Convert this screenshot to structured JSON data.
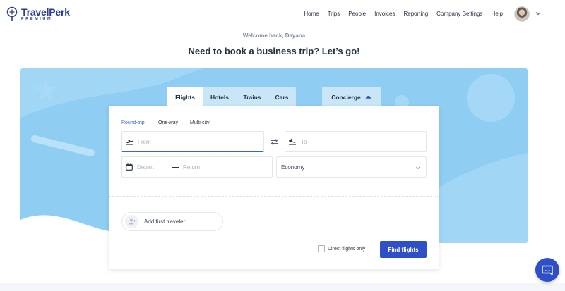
{
  "brand": {
    "name": "TravelPerk",
    "tier": "PREMIUM"
  },
  "nav": {
    "items": [
      {
        "label": "Home"
      },
      {
        "label": "Trips"
      },
      {
        "label": "People"
      },
      {
        "label": "Invoices"
      },
      {
        "label": "Reporting"
      },
      {
        "label": "Company Settings"
      },
      {
        "label": "Help"
      }
    ]
  },
  "greeting": {
    "welcome": "Welcome back, Dayana",
    "headline": "Need to book a business trip? Let’s go!"
  },
  "tabs": [
    {
      "label": "Flights",
      "active": true
    },
    {
      "label": "Hotels",
      "active": false
    },
    {
      "label": "Trains",
      "active": false
    },
    {
      "label": "Cars",
      "active": false
    }
  ],
  "concierge": {
    "label": "Concierge",
    "icon": "concierge-bell-icon"
  },
  "trip_types": [
    {
      "label": "Round-trip",
      "selected": true
    },
    {
      "label": "One-way",
      "selected": false
    },
    {
      "label": "Multi-city",
      "selected": false
    }
  ],
  "search": {
    "from_placeholder": "From",
    "to_placeholder": "To",
    "depart_placeholder": "Depart",
    "return_placeholder": "Return",
    "cabin_class": "Economy"
  },
  "traveler": {
    "label": "Add first traveler"
  },
  "filters": {
    "direct_label": "Direct flights only",
    "direct_checked": false
  },
  "actions": {
    "find_label": "Find flights"
  },
  "colors": {
    "brand": "#2b3c8f",
    "accent": "#3c63d8",
    "primary_button": "#2f4fc6",
    "hero_bg": "#8fcdf2",
    "tab_inactive": "#c9e6f8"
  }
}
